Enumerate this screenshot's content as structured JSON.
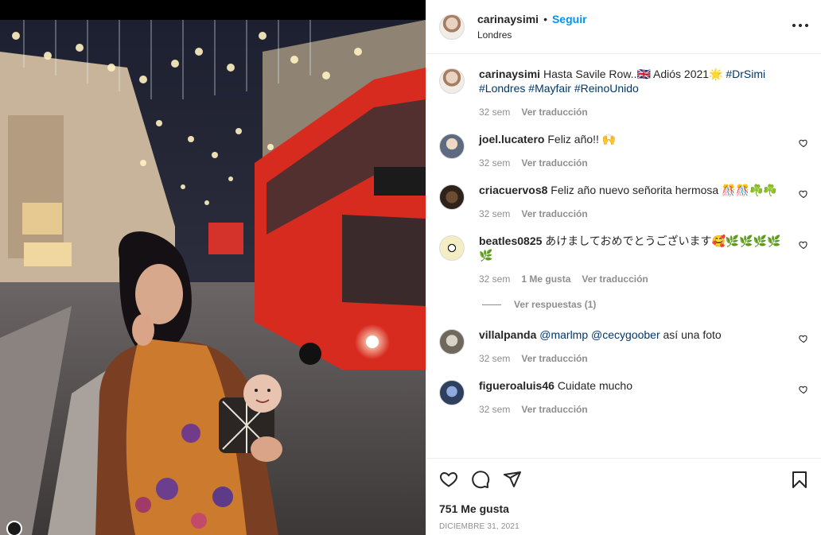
{
  "post": {
    "owner_username": "carinaysimi",
    "separator": "•",
    "follow_label": "Seguir",
    "location": "Londres",
    "more_icon": "more-horizontal-icon"
  },
  "caption": {
    "username": "carinaysimi",
    "text": "Hasta Savile Row..🇬🇧 Adiós 2021🌟",
    "tags": [
      "#DrSimi",
      "#Londres",
      "#Mayfair",
      "#ReinoUnido"
    ],
    "time": "32 sem",
    "translate": "Ver traducción"
  },
  "comments": [
    {
      "username": "joel.lucatero",
      "text": "Feliz año!! 🙌",
      "time": "32 sem",
      "likes": "",
      "translate": "Ver traducción",
      "avatar_color": "#c9b8a6"
    },
    {
      "username": "criacuervos8",
      "text": "Feliz año nuevo señorita hermosa 🎊🎊☘️☘️",
      "time": "32 sem",
      "likes": "",
      "translate": "Ver traducción",
      "avatar_color": "#3b2a1f"
    },
    {
      "username": "beatles0825",
      "text": "あけましておめでとうございます🥰🌿🌿🌿🌿🌿",
      "time": "32 sem",
      "likes": "1 Me gusta",
      "translate": "Ver traducción",
      "avatar_color": "#f3e7b0",
      "replies": "Ver respuestas (1)"
    },
    {
      "username": "villalpanda",
      "text_mentions": [
        "@marlmp",
        "@cecygoober"
      ],
      "text": "así una foto",
      "time": "32 sem",
      "likes": "",
      "translate": "Ver traducción",
      "avatar_color": "#8a8477"
    },
    {
      "username": "figueroaluis46",
      "text": "Cuidate mucho",
      "time": "32 sem",
      "likes": "",
      "translate": "Ver traducción",
      "avatar_color": "#3b4d6e"
    }
  ],
  "footer": {
    "likes": "751 Me gusta",
    "date": "DICIEMBRE 31, 2021",
    "icons": [
      "heart-icon",
      "comment-icon",
      "share-icon",
      "bookmark-icon"
    ]
  },
  "colors": {
    "accent": "#0095f6",
    "hashtag": "#00376b",
    "muted": "#8e8e8e",
    "text": "#262626"
  }
}
